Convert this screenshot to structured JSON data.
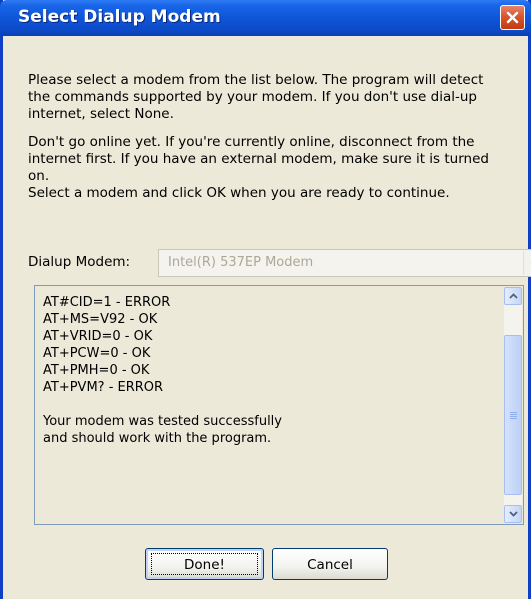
{
  "window": {
    "title": "Select Dialup Modem"
  },
  "instructions": {
    "paragraph1": "Please select a modem from the list below. The program will detect the commands supported by your modem. If you don't use dial-up internet, select None.",
    "paragraph2_line1": "Don't go online yet. If you're currently online, disconnect from the internet first. If you have an external modem, make sure it is turned on.",
    "paragraph2_line2": "Select a modem and click OK when you are ready to continue."
  },
  "dialup": {
    "label": "Dialup Modem:",
    "selected": "Intel(R) 537EP Modem"
  },
  "log": {
    "lines": [
      "AT#CID=1 - ERROR",
      "AT+MS=V92 - OK",
      "AT+VRID=0 - OK",
      "AT+PCW=0 - OK",
      "AT+PMH=0 - OK",
      "AT+PVM? - ERROR"
    ],
    "result_line1": "Your modem was tested successfully",
    "result_line2": "and should work with the program."
  },
  "buttons": {
    "done": "Done!",
    "cancel": "Cancel"
  },
  "colors": {
    "titlebar": "#0f55d8",
    "close": "#d9572f",
    "dialog_bg": "#ece9d8"
  },
  "icons": [
    "close-icon",
    "dropdown-arrow-icon",
    "scroll-up-icon",
    "scroll-down-icon"
  ]
}
